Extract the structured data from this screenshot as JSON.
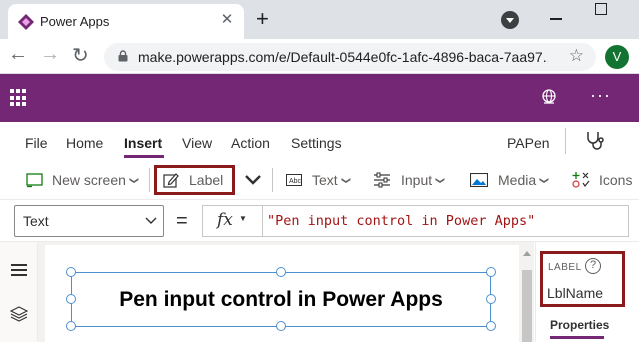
{
  "browser": {
    "tab_title": "Power Apps",
    "tab_close": "✕",
    "new_tab": "+",
    "url": "make.powerapps.com/e/Default-0544e0fc-1afc-4896-baca-7aa97...",
    "star": "☆",
    "profile_initial": "V",
    "back": "←",
    "forward": "→",
    "reload": "↻"
  },
  "app_header": {
    "more": "···"
  },
  "ribbon": {
    "tabs": [
      "File",
      "Home",
      "Insert",
      "View",
      "Action",
      "Settings"
    ],
    "active_tab": "Insert",
    "app_name": "PAPen"
  },
  "toolbar": {
    "new_screen": "New screen",
    "label": "Label",
    "text": "Text",
    "input": "Input",
    "media": "Media",
    "icons": "Icons"
  },
  "formula_bar": {
    "property": "Text",
    "equals": "=",
    "fx": "fx",
    "formula": "\"Pen input control in Power Apps\""
  },
  "canvas": {
    "label_text": "Pen input control in Power Apps"
  },
  "properties_panel": {
    "kind": "LABEL",
    "help": "?",
    "control_name": "LblName",
    "tab": "Properties"
  },
  "colors": {
    "brand_purple": "#742774",
    "highlight_box": "#8b1a1a",
    "selection_blue": "#4d8fd1",
    "formula_string": "#a31515"
  }
}
